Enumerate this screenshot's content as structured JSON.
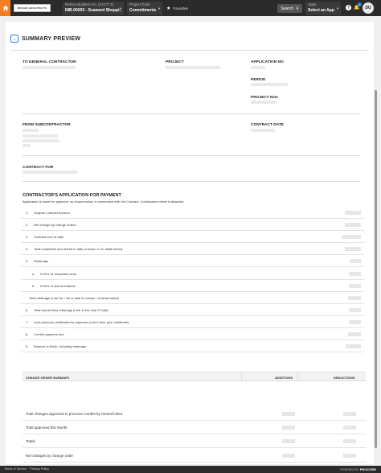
{
  "topbar": {
    "logo_text": "NISSAN ARCHITECTS",
    "company": "Nelson Builders Inc. (ACCT 2)",
    "project": "NIB-00003 - Seaward Shoppi...",
    "tool_label": "Project Tools",
    "tool_value": "Commitments",
    "favorites": "Favorites",
    "search": "Search",
    "apps_label": "Apps",
    "apps_value": "Select an App",
    "help": "?",
    "notif_count": "1",
    "avatar": "DU"
  },
  "summary": {
    "title": "SUMMARY PREVIEW",
    "to_gc": "TO GENERAL CONTRACTOR",
    "project": "PROJECT",
    "application_no": "APPLICATION NO",
    "period": "PERIOD",
    "project_nos": "PROJECT NOs",
    "from_sub": "FROM SUBCONTRACTOR",
    "contract_date": "CONTRACT DATE",
    "contract_for": "CONTRACT FOR"
  },
  "application": {
    "title": "CONTRACTOR'S APPLICATION FOR PAYMENT",
    "subtitle": "Application is made for payment, as shown below, in connection with the Contract. Continuation sheet is attached.",
    "rows": [
      {
        "num": "1.",
        "text": "Original Contract Amount"
      },
      {
        "num": "2.",
        "text": "Net change by change orders"
      },
      {
        "num": "3.",
        "text": "Contract sum to date"
      },
      {
        "num": "4.",
        "text": "Total completed and stored to date (Column G on detail sheet)"
      },
      {
        "num": "5.",
        "text": "Retainage"
      },
      {
        "num": "a.",
        "text": "0.00% of completed work"
      },
      {
        "num": "b.",
        "text": "0.00% of stored material"
      },
      {
        "num": "",
        "text": "Total retainage (Line 5a + 5b or total in column I of detail sheet)"
      },
      {
        "num": "6.",
        "text": "Total earned less retainage (Line 4 less Line 5 Total)"
      },
      {
        "num": "7.",
        "text": "Less previous certificates for payment (Line 6 from prior certificate)"
      },
      {
        "num": "8.",
        "text": "Current payment due"
      },
      {
        "num": "9.",
        "text": "Balance to finish, including retainage"
      }
    ]
  },
  "change_orders": {
    "col_summary": "CHANGE ORDER SUMMARY",
    "col_additions": "ADDITIONS",
    "col_deductions": "DEDUCTIONS",
    "rows": [
      {
        "text": "Total changes approved in previous months by Owner/Client"
      },
      {
        "text": "Total approved this Month"
      },
      {
        "text": "Totals"
      },
      {
        "text": "Net changes by change order"
      }
    ]
  },
  "footer": {
    "terms": "Terms of Service",
    "privacy": "Privacy Policy",
    "powered": "POWERED BY",
    "brand": "PROCORE"
  }
}
